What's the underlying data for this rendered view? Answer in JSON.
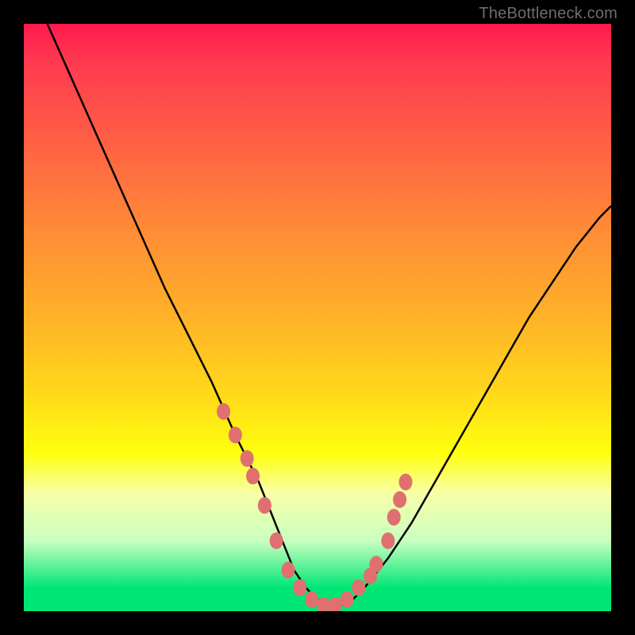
{
  "attribution": "TheBottleneck.com",
  "colors": {
    "frame": "#000000",
    "gradient_top": "#ff1a4d",
    "gradient_mid": "#ffd91a",
    "gradient_bottom": "#00e676",
    "curve": "#000000",
    "dots": "#e07070"
  },
  "chart_data": {
    "type": "line",
    "title": "",
    "xlabel": "",
    "ylabel": "",
    "xlim": [
      0,
      100
    ],
    "ylim": [
      0,
      100
    ],
    "series": [
      {
        "name": "bottleneck-curve",
        "x": [
          4,
          8,
          12,
          16,
          20,
          24,
          28,
          32,
          36,
          38,
          40,
          42,
          44,
          46,
          48,
          50,
          52,
          54,
          56,
          58,
          62,
          66,
          70,
          74,
          78,
          82,
          86,
          90,
          94,
          98,
          100
        ],
        "y": [
          100,
          91,
          82,
          73,
          64,
          55,
          47,
          39,
          30,
          26,
          22,
          17,
          12,
          7,
          4,
          2,
          1,
          1,
          2,
          4,
          9,
          15,
          22,
          29,
          36,
          43,
          50,
          56,
          62,
          67,
          69
        ]
      }
    ],
    "scatter_points": {
      "name": "highlight-dots",
      "x": [
        34,
        36,
        38,
        39,
        41,
        43,
        45,
        47,
        49,
        51,
        53,
        55,
        57,
        59,
        60,
        62,
        63,
        64,
        65
      ],
      "y": [
        34,
        30,
        26,
        23,
        18,
        12,
        7,
        4,
        2,
        1,
        1,
        2,
        4,
        6,
        8,
        12,
        16,
        19,
        22
      ]
    }
  }
}
